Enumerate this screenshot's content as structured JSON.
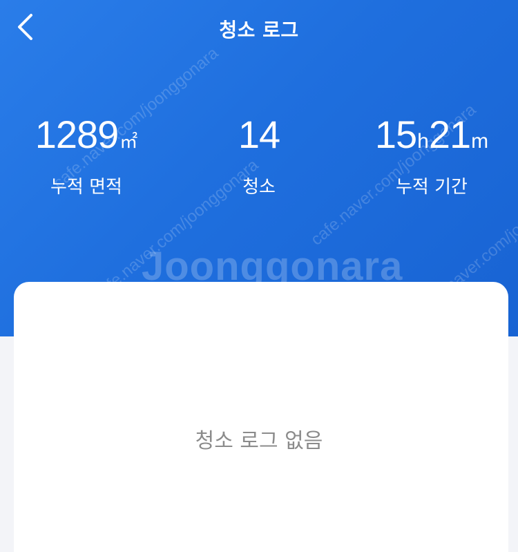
{
  "header": {
    "title": "청소 로그",
    "back_icon": "chevron-left-icon"
  },
  "stats": {
    "area": {
      "value": "1289",
      "unit": "㎡",
      "label": "누적 면적"
    },
    "count": {
      "value": "14",
      "label": "청소"
    },
    "duration": {
      "hours": "15",
      "hours_unit": "h",
      "minutes": "21",
      "minutes_unit": "m",
      "label": "누적 기간"
    }
  },
  "log": {
    "empty_text": "청소 로그 없음"
  },
  "watermark": {
    "main": "Joonggonara",
    "small": "cafe.naver.com/joonggonara"
  },
  "colors": {
    "hero_bg": "#1f6fde",
    "card_bg": "#ffffff",
    "page_bg": "#f3f4f8",
    "empty_text": "#8b8b8b"
  }
}
